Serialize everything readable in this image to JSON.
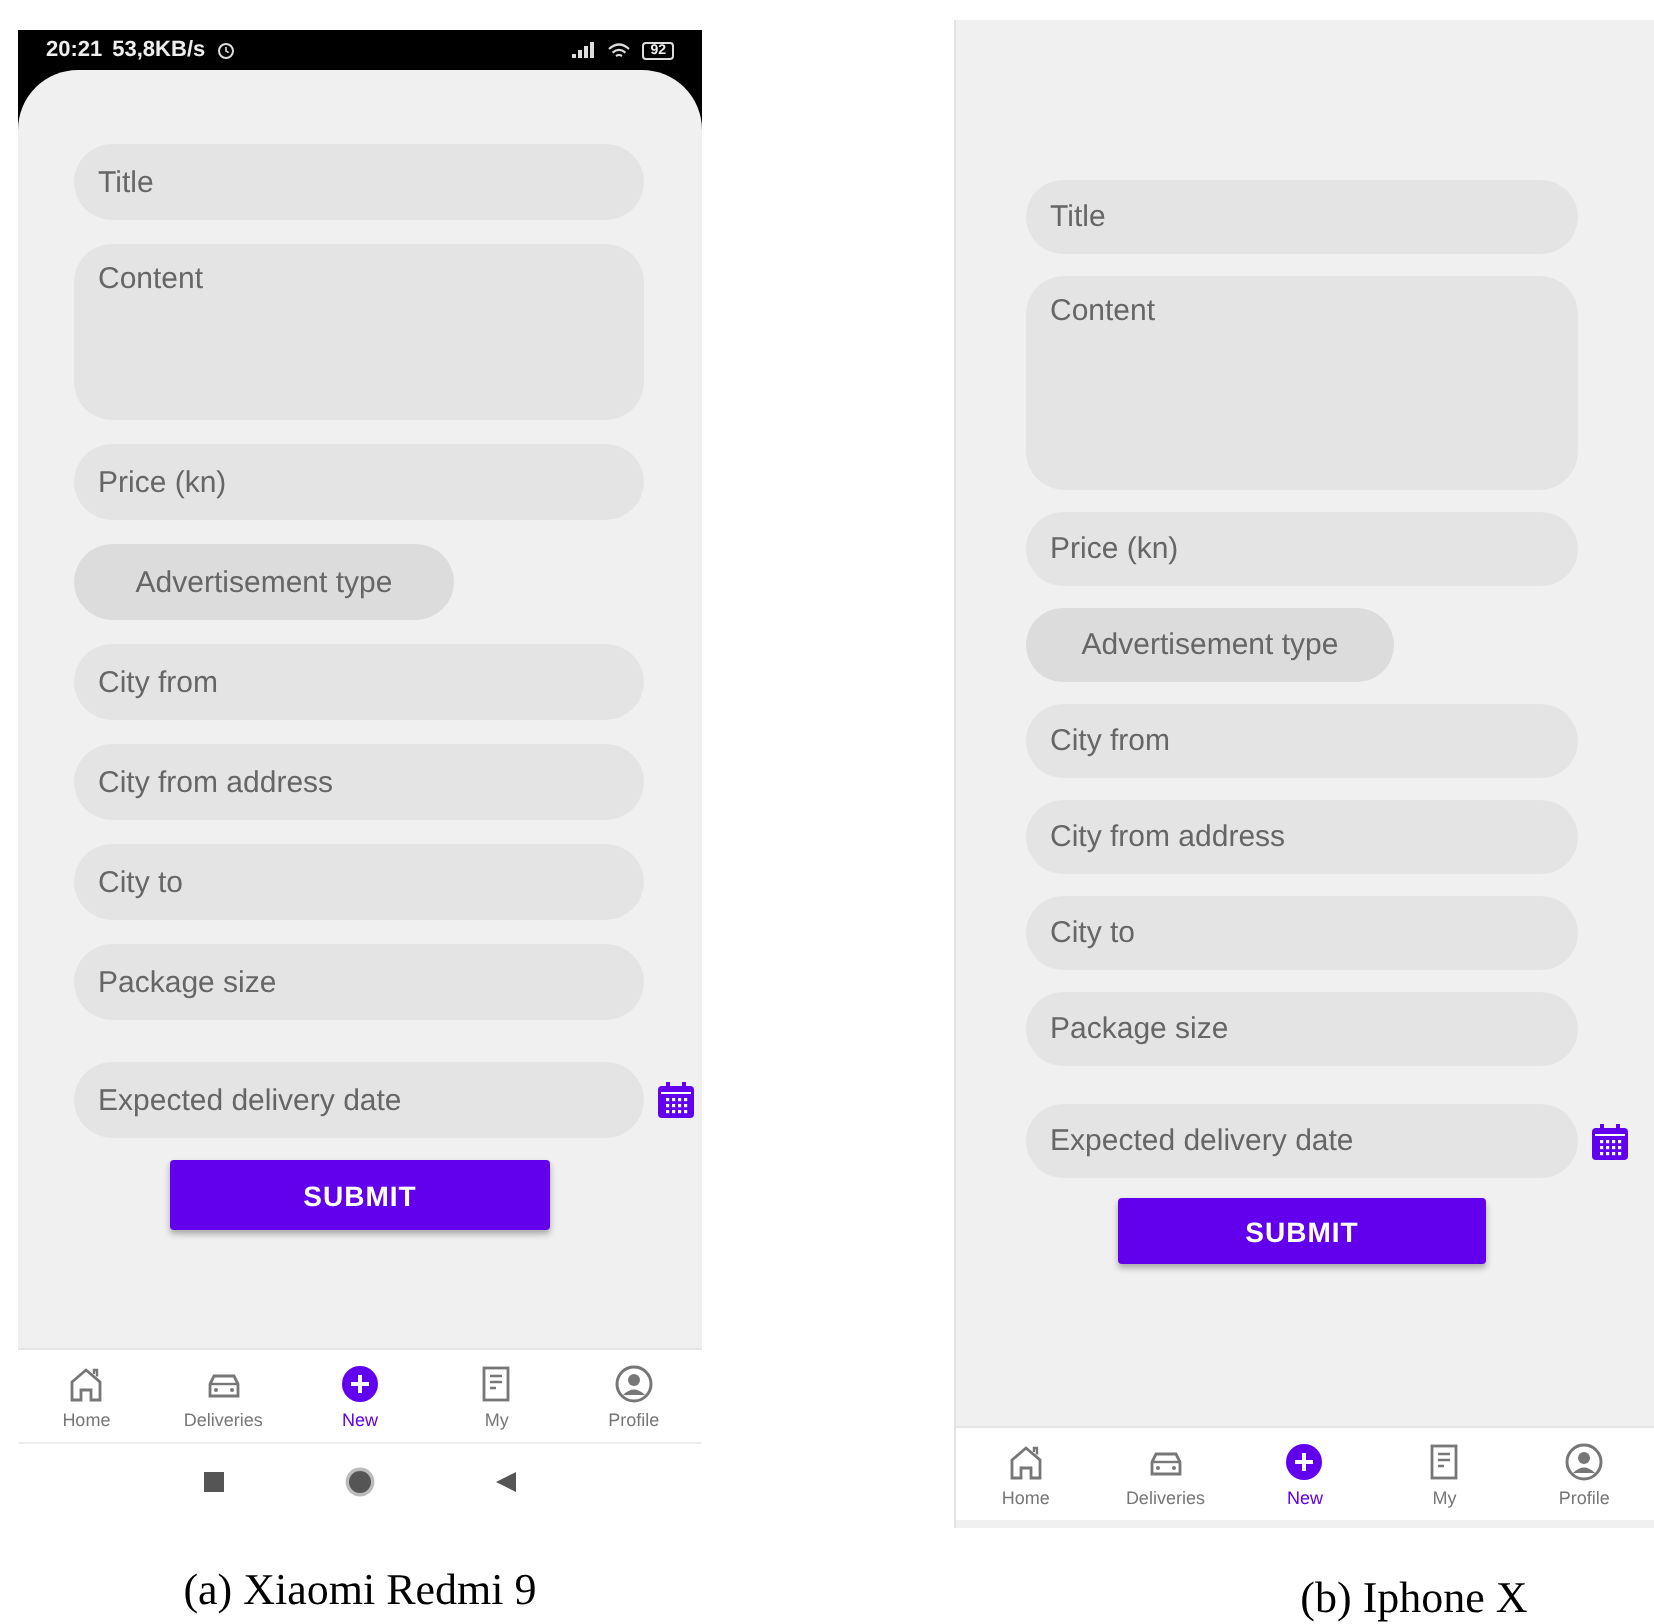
{
  "phones": [
    {
      "kind": "android",
      "caption": "(a) Xiaomi Redmi 9",
      "status_bar": {
        "time": "20:21",
        "speed": "53,8KB/s",
        "battery": "92"
      },
      "fields": [
        {
          "kind": "text",
          "placeholder": "Title"
        },
        {
          "kind": "textarea",
          "placeholder": "Content"
        },
        {
          "kind": "text",
          "placeholder": "Price (kn)"
        },
        {
          "kind": "select",
          "label": "Advertisement type"
        },
        {
          "kind": "text",
          "placeholder": "City from"
        },
        {
          "kind": "text",
          "placeholder": "City from address"
        },
        {
          "kind": "text",
          "placeholder": "City to"
        },
        {
          "kind": "text",
          "placeholder": "Package size"
        },
        {
          "kind": "date",
          "placeholder": "Expected delivery date"
        }
      ],
      "submit": "SUBMIT",
      "nav": [
        {
          "label": "Home",
          "selected": false
        },
        {
          "label": "Deliveries",
          "selected": false
        },
        {
          "label": "New",
          "selected": true
        },
        {
          "label": "My",
          "selected": false
        },
        {
          "label": "Profile",
          "selected": false
        }
      ]
    },
    {
      "kind": "ios",
      "caption": "(b) Iphone X",
      "fields": [
        {
          "kind": "text",
          "placeholder": "Title"
        },
        {
          "kind": "textarea",
          "placeholder": "Content"
        },
        {
          "kind": "text",
          "placeholder": "Price (kn)"
        },
        {
          "kind": "select",
          "label": "Advertisement type"
        },
        {
          "kind": "text",
          "placeholder": "City from"
        },
        {
          "kind": "text",
          "placeholder": "City from address"
        },
        {
          "kind": "text",
          "placeholder": "City to"
        },
        {
          "kind": "text",
          "placeholder": "Package size"
        },
        {
          "kind": "date",
          "placeholder": "Expected delivery date"
        }
      ],
      "submit": "SUBMIT",
      "nav": [
        {
          "label": "Home",
          "selected": false
        },
        {
          "label": "Deliveries",
          "selected": false
        },
        {
          "label": "New",
          "selected": true
        },
        {
          "label": "My",
          "selected": false
        },
        {
          "label": "Profile",
          "selected": false
        }
      ]
    }
  ]
}
